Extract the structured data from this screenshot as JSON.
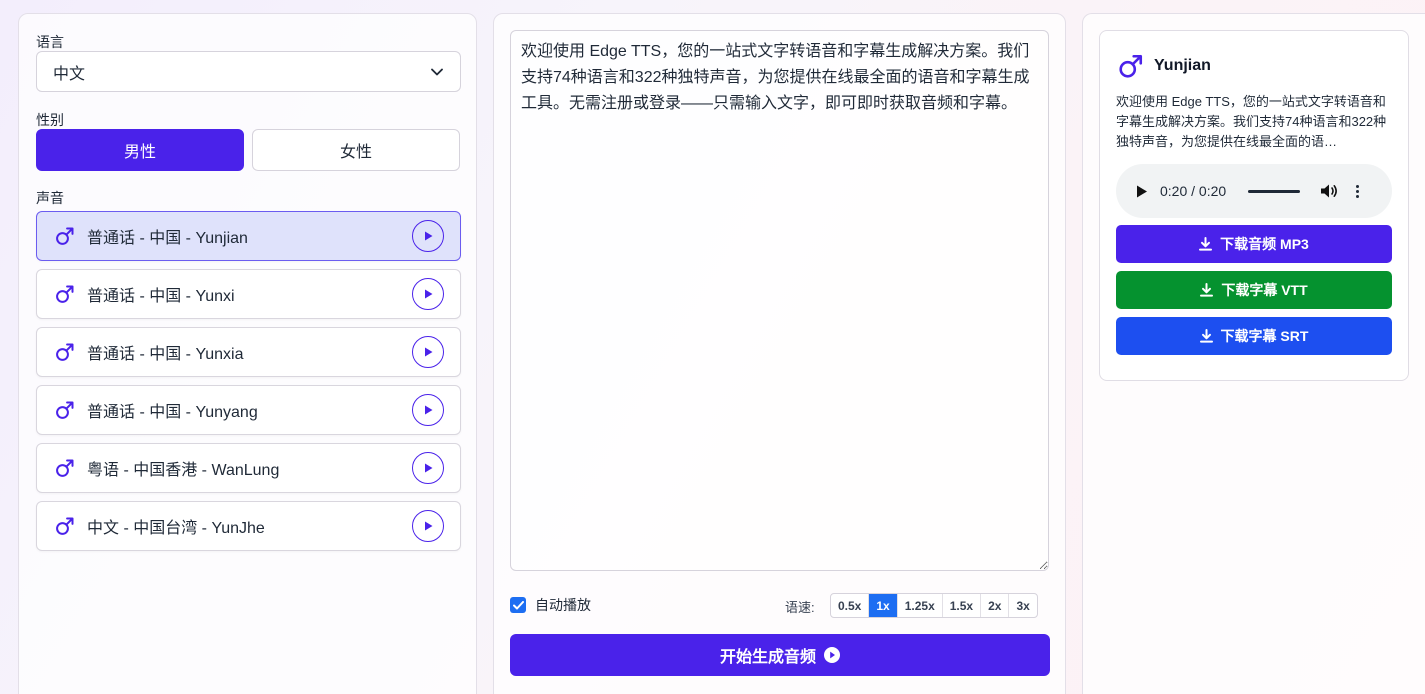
{
  "language": {
    "label": "语言",
    "selected": "中文"
  },
  "gender": {
    "label": "性别",
    "male": "男性",
    "female": "女性",
    "active": "male"
  },
  "voices": {
    "label": "声音",
    "items": [
      {
        "name": "普通话 - 中国 - Yunjian",
        "selected": true
      },
      {
        "name": "普通话 - 中国 - Yunxi",
        "selected": false
      },
      {
        "name": "普通话 - 中国 - Yunxia",
        "selected": false
      },
      {
        "name": "普通话 - 中国 - Yunyang",
        "selected": false
      },
      {
        "name": "粤语 - 中国香港 - WanLung",
        "selected": false
      },
      {
        "name": "中文 - 中国台湾 - YunJhe",
        "selected": false
      }
    ]
  },
  "editor": {
    "text": "欢迎使用 Edge TTS，您的一站式文字转语音和字幕生成解决方案。我们支持74种语言和322种独特声音，为您提供在线最全面的语音和字幕生成工具。无需注册或登录——只需输入文字，即可即时获取音频和字幕。"
  },
  "controls": {
    "autoplay_label": "自动播放",
    "autoplay_checked": true,
    "speed_label": "语速:",
    "speeds": [
      "0.5x",
      "1x",
      "1.25x",
      "1.5x",
      "2x",
      "3x"
    ],
    "speed_selected": "1x",
    "generate_label": "开始生成音频"
  },
  "result": {
    "voice_name": "Yunjian",
    "preview": "欢迎使用 Edge TTS，您的一站式文字转语音和字幕生成解决方案。我们支持74种语言和322种独特声音，为您提供在线最全面的语…",
    "audio_time": "0:20 / 0:20",
    "download_mp3": "下载音频 MP3",
    "download_vtt": "下载字幕 VTT",
    "download_srt": "下载字幕 SRT"
  },
  "colors": {
    "primary": "#4a22ea",
    "vtt_green": "#05922f",
    "srt_blue": "#1d4ff0",
    "selected_voice_bg": "#dfe2fb"
  }
}
